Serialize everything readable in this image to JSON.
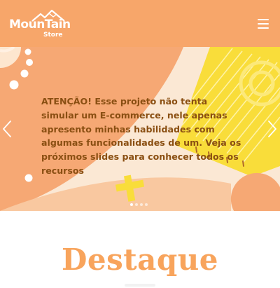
{
  "header": {
    "logo_title": "MounTain",
    "logo_subtitle": "Store",
    "menu_icon": "hamburger-menu-icon"
  },
  "carousel": {
    "message": "ATENÇÃO! Esse projeto não tenta simular um E-commerce, nele apenas apresento minhas habilidades com algumas funcionalidades de um. Veja os próximos slides para conhecer todos os recursos",
    "prev_icon": "chevron-left-icon",
    "next_icon": "chevron-right-icon",
    "slide_count": 4,
    "active_slide": 1
  },
  "section": {
    "title": "Destaque"
  },
  "colors": {
    "header_bg": "#f7a66a",
    "accent_yellow": "#f9dd3a",
    "text_brown": "#8a4f12",
    "heading_orange": "#f8a45c"
  }
}
